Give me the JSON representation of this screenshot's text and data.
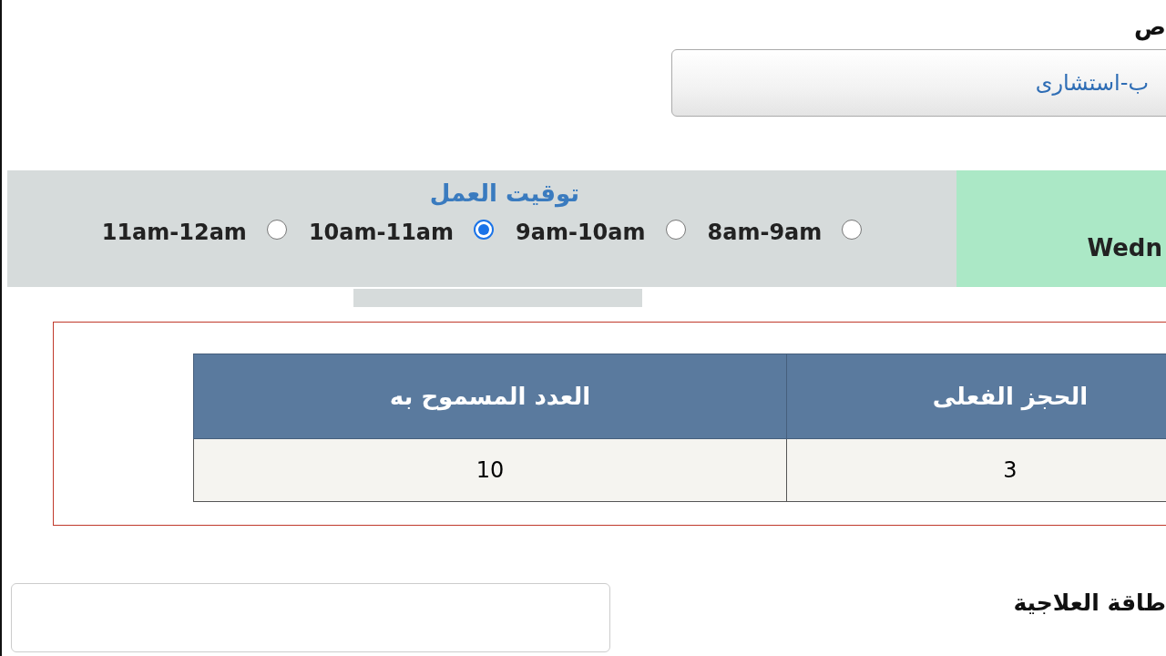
{
  "specialty": {
    "label": "ص",
    "value": "ب-استشارى"
  },
  "schedule": {
    "day": "Wedn",
    "title": "توقيت العمل",
    "slots": [
      {
        "label": "8am-9am",
        "selected": false
      },
      {
        "label": "9am-10am",
        "selected": false
      },
      {
        "label": "10am-11am",
        "selected": true
      },
      {
        "label": "11am-12am",
        "selected": false
      }
    ]
  },
  "table": {
    "columns": [
      "الحجز الفعلى",
      "العدد المسموح به"
    ],
    "rows": [
      [
        "3",
        "10"
      ]
    ]
  },
  "card": {
    "label": "طاقة العلاجية"
  }
}
